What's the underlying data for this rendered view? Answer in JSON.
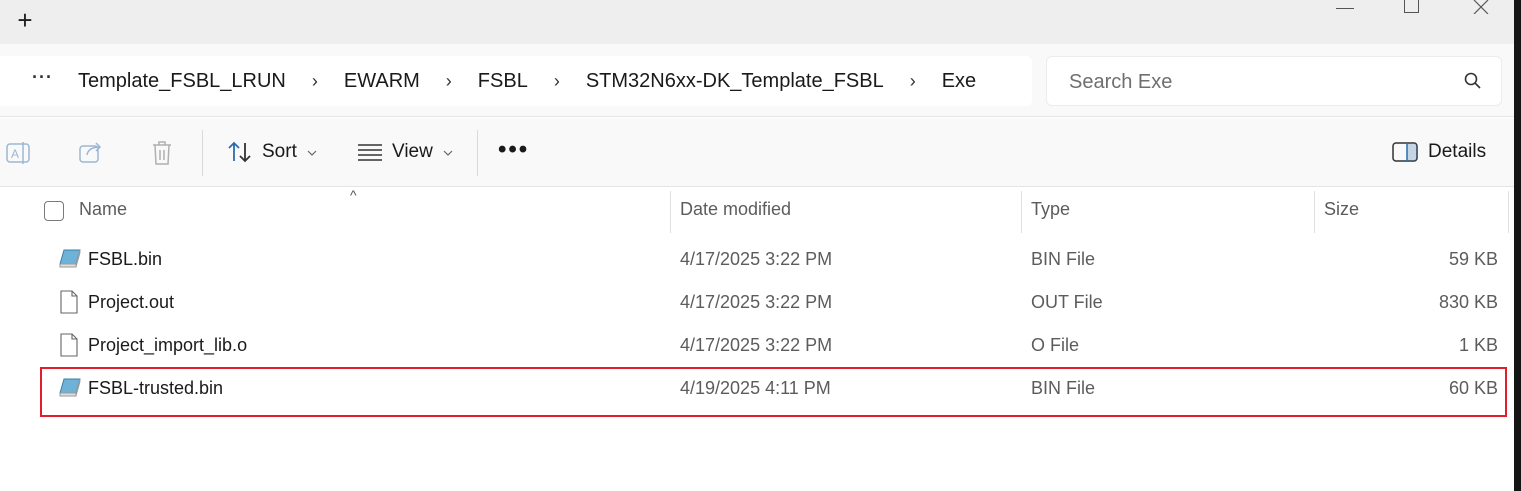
{
  "titlebar": {
    "new_tab_label": "+"
  },
  "breadcrumb": {
    "more_label": "···",
    "separator": "›",
    "items": [
      "Template_FSBL_LRUN",
      "EWARM",
      "FSBL",
      "STM32N6xx-DK_Template_FSBL",
      "Exe"
    ]
  },
  "search": {
    "placeholder": "Search Exe"
  },
  "toolbar": {
    "sort_label": "Sort",
    "view_label": "View",
    "more_label": "•••",
    "details_label": "Details"
  },
  "columns": {
    "name": "Name",
    "date": "Date modified",
    "type": "Type",
    "size": "Size"
  },
  "files": [
    {
      "name": "FSBL.bin",
      "date": "4/17/2025 3:22 PM",
      "type": "BIN File",
      "size": "59 KB",
      "icon": "bin-file-icon"
    },
    {
      "name": "Project.out",
      "date": "4/17/2025 3:22 PM",
      "type": "OUT File",
      "size": "830 KB",
      "icon": "document-file-icon"
    },
    {
      "name": "Project_import_lib.o",
      "date": "4/17/2025 3:22 PM",
      "type": "O File",
      "size": "1 KB",
      "icon": "document-file-icon"
    },
    {
      "name": "FSBL-trusted.bin",
      "date": "4/19/2025 4:11 PM",
      "type": "BIN File",
      "size": "60 KB",
      "icon": "bin-file-icon",
      "highlighted": true
    }
  ],
  "colors": {
    "highlight": "#e01f2a",
    "toolbar_bg": "#f9f9f9",
    "titlebar_bg": "#eeeeee"
  }
}
